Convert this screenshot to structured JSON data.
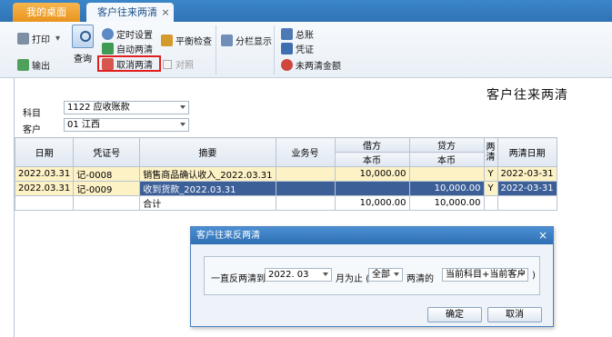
{
  "tabs": {
    "home": "我的桌面",
    "active": "客户往来两清",
    "close": "×"
  },
  "toolbar": {
    "print": "打印",
    "print_dropdown": "▾",
    "export": "输出",
    "query": "查询",
    "timer_settings": "定时设置",
    "auto_reconcile": "自动两清",
    "cancel_reconcile": "取消两清",
    "balance_check": "平衡检查",
    "compare": "对照",
    "split_view": "分栏显示",
    "ledger": "总账",
    "voucher": "凭证",
    "unreconciled_amount": "未两清金额"
  },
  "title": "客户往来两清",
  "filters": {
    "subject_label": "科目",
    "subject_value": "1122 应收账款",
    "customer_label": "客户",
    "customer_value": "01 江西"
  },
  "grid": {
    "headers": {
      "date": "日期",
      "voucher_no": "凭证号",
      "summary": "摘要",
      "business_no": "业务号",
      "debit": "借方",
      "credit": "贷方",
      "debit_sub": "本币",
      "credit_sub": "本币",
      "reconciled": "两清",
      "reconcile_date": "两清日期"
    },
    "rows": [
      {
        "date": "2022.03.31",
        "voucher": "记-0008",
        "summary": "销售商品确认收入_2022.03.31",
        "business": "",
        "debit": "10,000.00",
        "credit": "",
        "flag": "Y",
        "rdate": "2022-03-31"
      },
      {
        "date": "2022.03.31",
        "voucher": "记-0009",
        "summary": "收到货款_2022.03.31",
        "business": "",
        "debit": "",
        "credit": "10,000.00",
        "flag": "Y",
        "rdate": "2022-03-31"
      }
    ],
    "total": {
      "label": "合计",
      "debit": "10,000.00",
      "credit": "10,000.00"
    }
  },
  "dialog": {
    "title": "客户往来反两清",
    "close": "×",
    "prefix": "一直反两清到",
    "period_value": "2022. 03",
    "month_text": "月为止 (",
    "scope_value": "全部",
    "reconciled_of": "两清的",
    "target_value": "当前科目+当前客户",
    "close_paren": ")",
    "ok": "确定",
    "cancel": "取消"
  },
  "colors": {
    "tab_bar": "#2f73b6",
    "home_tab": "#e9941e",
    "selected_row": "#3d5f98",
    "highlight_row": "#fdf1c6",
    "callout": "#e02020"
  }
}
